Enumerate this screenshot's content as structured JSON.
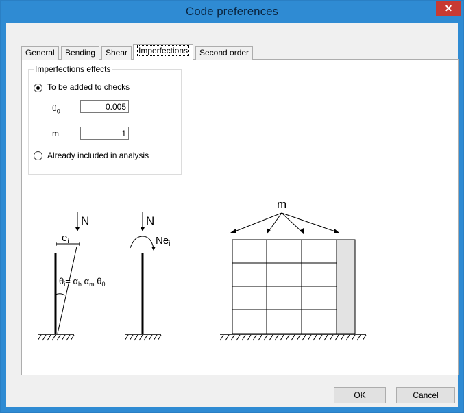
{
  "window": {
    "title": "Code preferences",
    "close_glyph": "✕"
  },
  "tabs": [
    {
      "label": "General"
    },
    {
      "label": "Bending"
    },
    {
      "label": "Shear"
    },
    {
      "label": "Imperfections",
      "active": true
    },
    {
      "label": "Second order"
    }
  ],
  "imperfections_group": {
    "title": "Imperfections effects",
    "option_added": "To be added to checks",
    "theta_label": "θ",
    "theta_sub": "0",
    "theta_value": "0.005",
    "m_label": "m",
    "m_value": "1",
    "option_included": "Already included in analysis"
  },
  "diagram": {
    "n1": "N",
    "ei": "e",
    "ei_sub": "i",
    "theta_eq": "θ",
    "theta_eq_sub": "i",
    "alpha_h": "= α",
    "alpha_h_sub": "h",
    "alpha_m": " α",
    "alpha_m_sub": "m",
    "theta0": " θ",
    "theta0_sub": "0",
    "n2": "N",
    "ne": "Ne",
    "ne_sub": "i",
    "m": "m"
  },
  "buttons": {
    "ok": "OK",
    "cancel": "Cancel"
  }
}
